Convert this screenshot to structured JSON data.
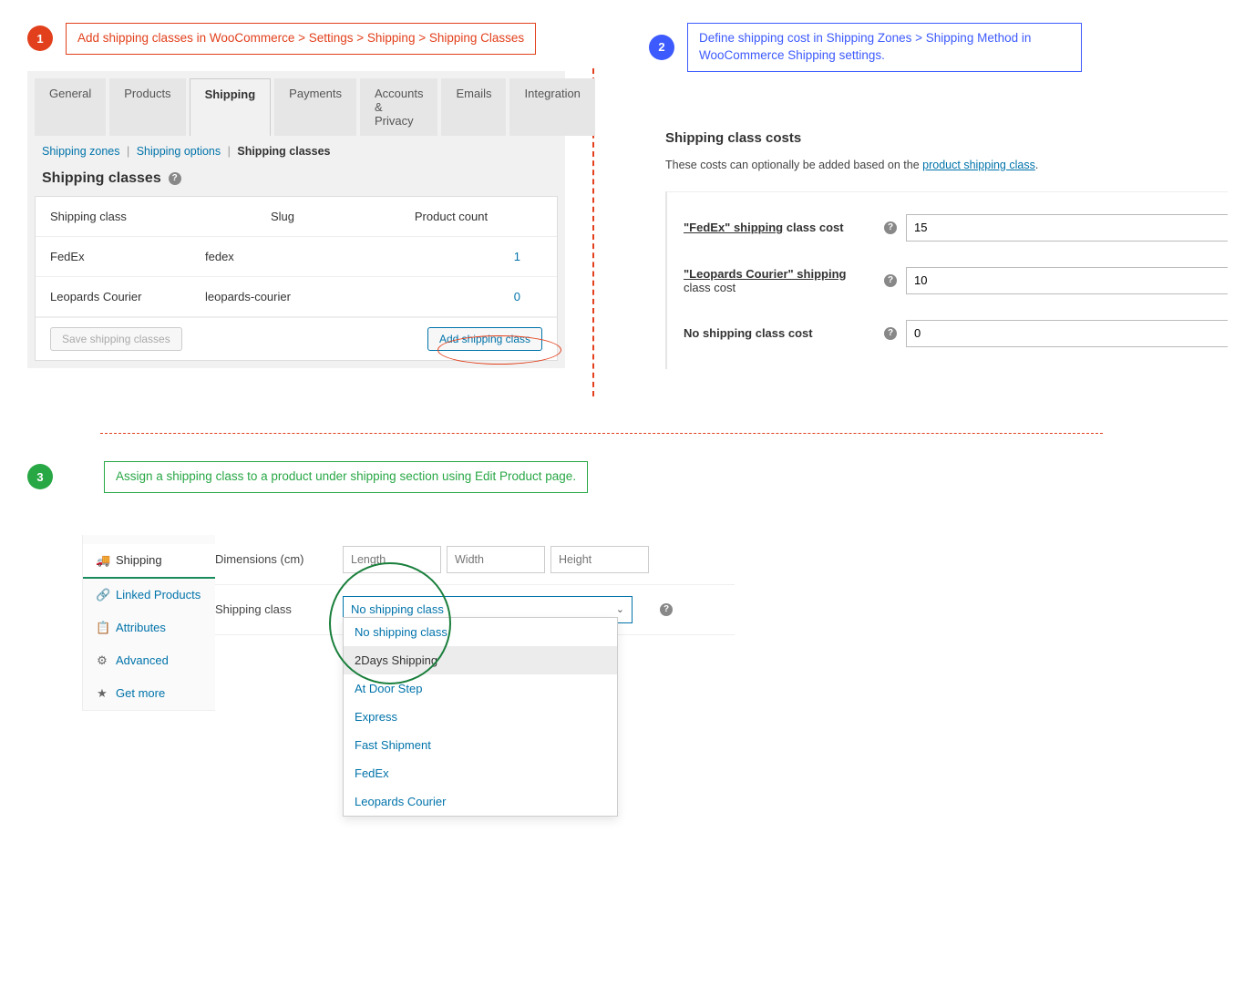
{
  "step1": {
    "badge": "1",
    "note": "Add shipping classes in WooCommerce > Settings > Shipping > Shipping Classes",
    "tabs": [
      "General",
      "Products",
      "Shipping",
      "Payments",
      "Accounts & Privacy",
      "Emails",
      "Integration"
    ],
    "active_tab": "Shipping",
    "sublinks": {
      "zones": "Shipping zones",
      "options": "Shipping options",
      "classes": "Shipping classes"
    },
    "heading": "Shipping classes",
    "table": {
      "headers": {
        "name": "Shipping class",
        "slug": "Slug",
        "count": "Product count"
      },
      "rows": [
        {
          "name": "FedEx",
          "slug": "fedex",
          "count": "1"
        },
        {
          "name": "Leopards Courier",
          "slug": "leopards-courier",
          "count": "0"
        }
      ],
      "save_label": "Save shipping classes",
      "add_label": "Add shipping class"
    }
  },
  "step2": {
    "badge": "2",
    "note": "Define shipping cost in Shipping Zones > Shipping Method in WooCommerce Shipping settings.",
    "heading": "Shipping class costs",
    "desc_pre": "These costs can optionally be added based on the ",
    "desc_link": "product shipping class",
    "desc_post": ".",
    "rows": [
      {
        "quoted": "\"FedEx\" shipping",
        "rest": " class cost",
        "value": "15"
      },
      {
        "quoted": "\"Leopards Courier\" shipping",
        "rest": " class cost",
        "value": "10"
      },
      {
        "plain": "No shipping class cost",
        "value": "0"
      }
    ]
  },
  "step3": {
    "badge": "3",
    "note": "Assign a shipping class to a product under shipping section using Edit Product page.",
    "sidebar": [
      {
        "label": "Shipping",
        "active": true
      },
      {
        "label": "Linked Products"
      },
      {
        "label": "Attributes"
      },
      {
        "label": "Advanced"
      },
      {
        "label": "Get more"
      }
    ],
    "dims_label": "Dimensions (cm)",
    "dims_placeholders": {
      "l": "Length",
      "w": "Width",
      "h": "Height"
    },
    "class_label": "Shipping class",
    "selected": "No shipping class",
    "options": [
      "No shipping class",
      "2Days Shipping",
      "At Door Step",
      "Express",
      "Fast Shipment",
      "FedEx",
      "Leopards Courier"
    ],
    "highlight_option": "2Days Shipping"
  }
}
